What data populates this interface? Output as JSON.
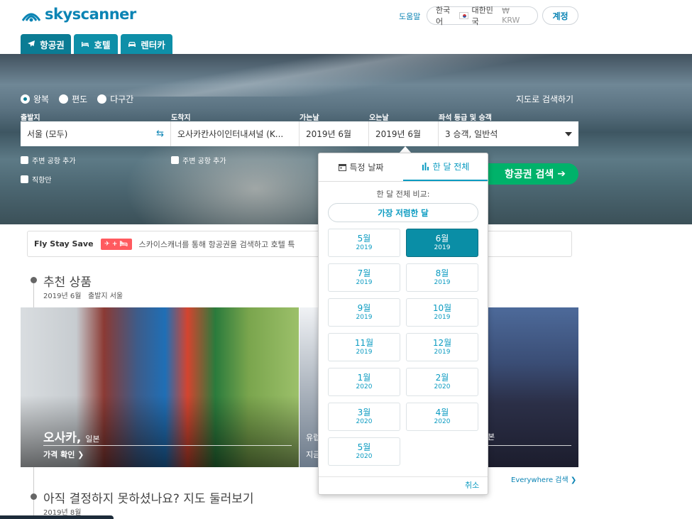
{
  "header": {
    "logo_text": "skyscanner",
    "help": "도움말",
    "locale": {
      "language": "한국어",
      "country": "대한민국",
      "currency": "₩ KRW"
    },
    "account": "계정"
  },
  "tabs": [
    {
      "label": "항공권",
      "icon": "plane-icon"
    },
    {
      "label": "호텔",
      "icon": "bed-icon"
    },
    {
      "label": "렌터카",
      "icon": "car-icon"
    }
  ],
  "trip_type": {
    "round": "왕복",
    "oneway": "편도",
    "multi": "다구간",
    "selected": "왕복"
  },
  "map_search": "지도로 검색하기",
  "form": {
    "origin_label": "출발지",
    "origin_value": "서울 (모두)",
    "dest_label": "도착지",
    "dest_value": "오사카칸사이인터내셔널 (K...",
    "depart_label": "가는날",
    "depart_value": "2019년 6월",
    "return_label": "오는날",
    "return_value": "2019년 6월",
    "cabin_label": "좌석 등급 및 승객",
    "cabin_value": "3 승객, 일반석",
    "nearby_origin": "주변 공항 추가",
    "nearby_dest": "주변 공항 추가",
    "direct_only": "직항만",
    "search_button": "항공권 검색"
  },
  "fly_stay_save": {
    "title": "Fly Stay Save",
    "badge": "✈ + 🛏",
    "text": "스카이스캐너를 통해 항공권을 검색하고 호텔 특"
  },
  "recommended": {
    "title": "추천 상품",
    "date": "2019년 6월",
    "origin": "출발지 서울",
    "card1_city": "오사카,",
    "card1_country": "일본",
    "card1_link": "가격 확인",
    "card2_text1": "유럽",
    "card2_text2": "지금",
    "card3_text": "본",
    "everywhere": "Everywhere 검색"
  },
  "undecided": {
    "title": "아직 결정하지 못하셨나요? 지도 둘러보기",
    "date": "2019년 8월"
  },
  "date_popover": {
    "tab_specific": "특정 날짜",
    "tab_whole_month": "한 달 전체",
    "compare_label": "한 달 전체 비교:",
    "cheapest": "가장 저렴한 달",
    "cancel": "취소",
    "selected_index": 1,
    "months": [
      {
        "m": "5월",
        "y": "2019"
      },
      {
        "m": "6월",
        "y": "2019"
      },
      {
        "m": "7월",
        "y": "2019"
      },
      {
        "m": "8월",
        "y": "2019"
      },
      {
        "m": "9월",
        "y": "2019"
      },
      {
        "m": "10월",
        "y": "2019"
      },
      {
        "m": "11월",
        "y": "2019"
      },
      {
        "m": "12월",
        "y": "2019"
      },
      {
        "m": "1월",
        "y": "2020"
      },
      {
        "m": "2월",
        "y": "2020"
      },
      {
        "m": "3월",
        "y": "2020"
      },
      {
        "m": "4월",
        "y": "2020"
      },
      {
        "m": "5월",
        "y": "2020"
      }
    ]
  }
}
